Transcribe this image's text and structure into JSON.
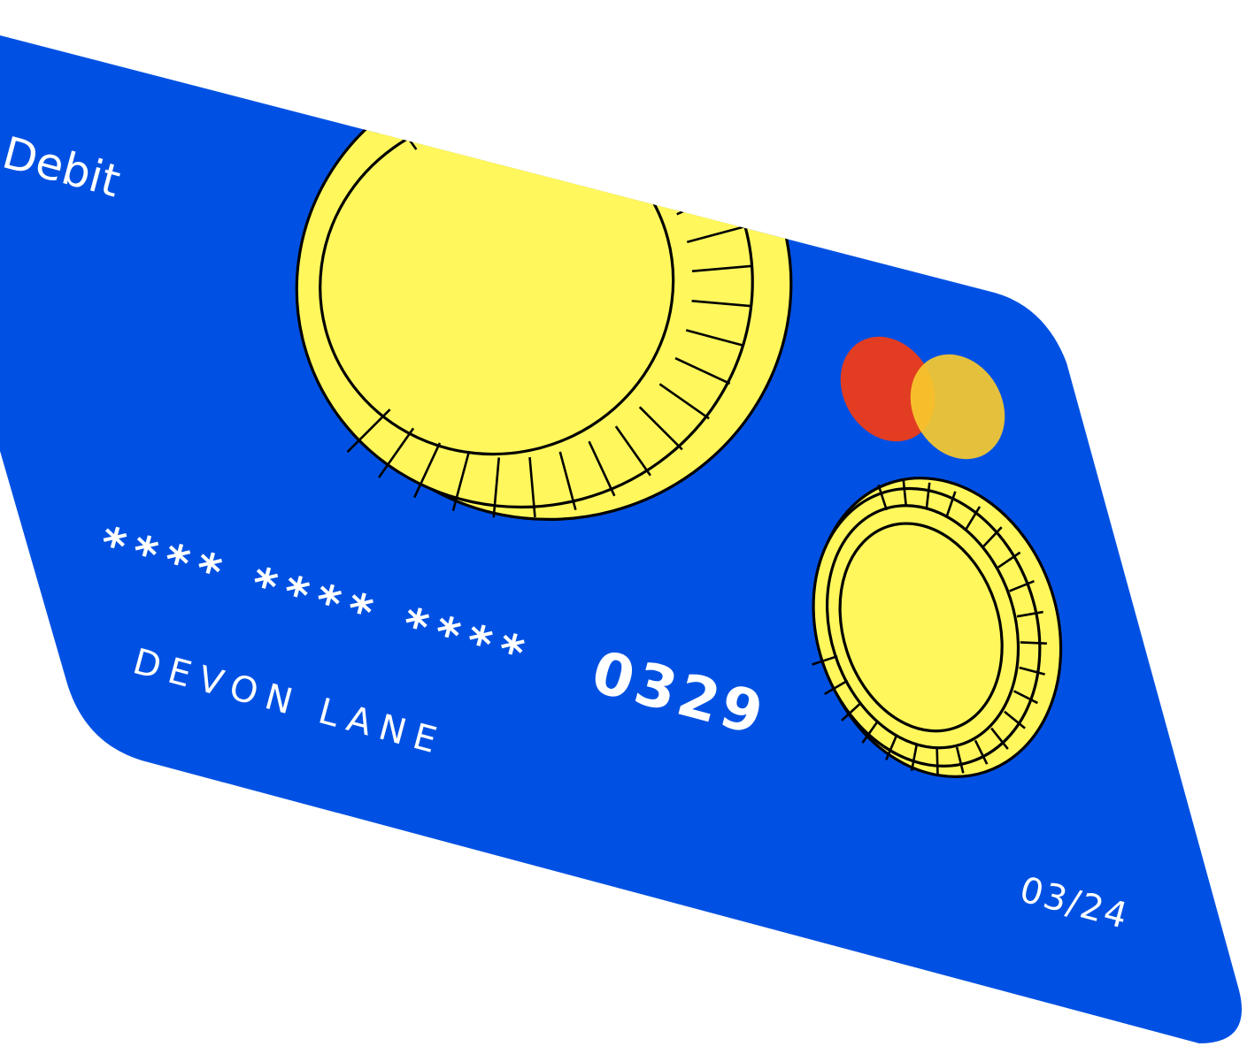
{
  "card": {
    "type_label": "Debit",
    "number": "**** **** **** 0329",
    "number_masked": "**** **** ****",
    "number_last4": "0329",
    "holder_name": "DEVON LANE",
    "expiry": "03/24"
  },
  "brand_logo": {
    "icon": "mastercard-logo-icon",
    "circle_left_color": "#E23C22",
    "circle_right_color": "#F8CA2E",
    "overlap_color": "#F6A22C"
  },
  "colors": {
    "card": "#0051E3",
    "coin": "#FFF75C",
    "outline": "#000000",
    "text": "#FFFFFF",
    "background": "#FFFFFF"
  },
  "decorations": [
    "large-coin-icon",
    "small-coin-icon"
  ]
}
